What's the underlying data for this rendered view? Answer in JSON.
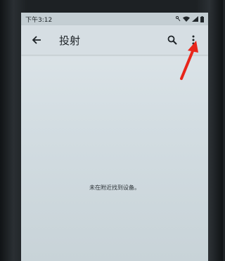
{
  "status_bar": {
    "time": "下午3:12"
  },
  "app_bar": {
    "title": "投射"
  },
  "content": {
    "empty_message": "未在附近找到设备。"
  },
  "icons": {
    "back": "arrow-back-icon",
    "search": "search-icon",
    "more": "more-vert-icon"
  },
  "colors": {
    "annotation_arrow": "#e8251a",
    "screen_bg": "#d8e1e5"
  }
}
